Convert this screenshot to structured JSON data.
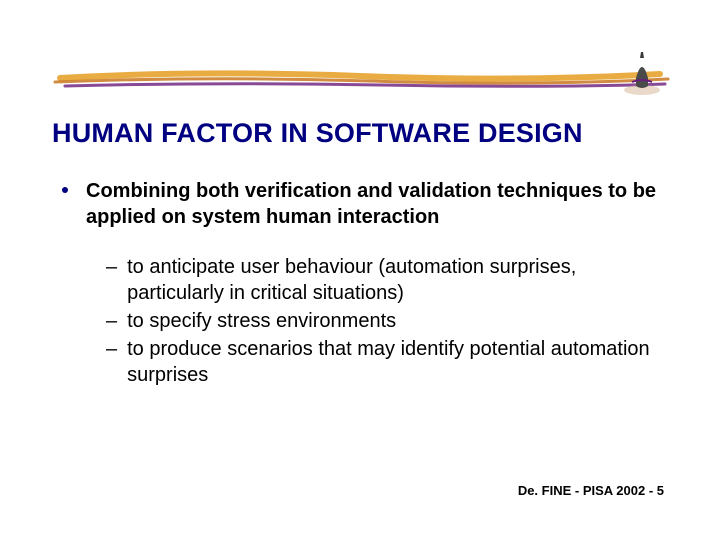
{
  "title": "HUMAN FACTOR IN SOFTWARE DESIGN",
  "main": {
    "text": "Combining both verification and validation techniques to be applied on system human interaction"
  },
  "sub": {
    "item1": "to anticipate user behaviour (automation surprises, particularly in critical situations)",
    "item2": "to specify stress environments",
    "item3": "to produce scenarios that may identify potential automation surprises"
  },
  "footer": "De. FINE - PISA 2002 - 5"
}
